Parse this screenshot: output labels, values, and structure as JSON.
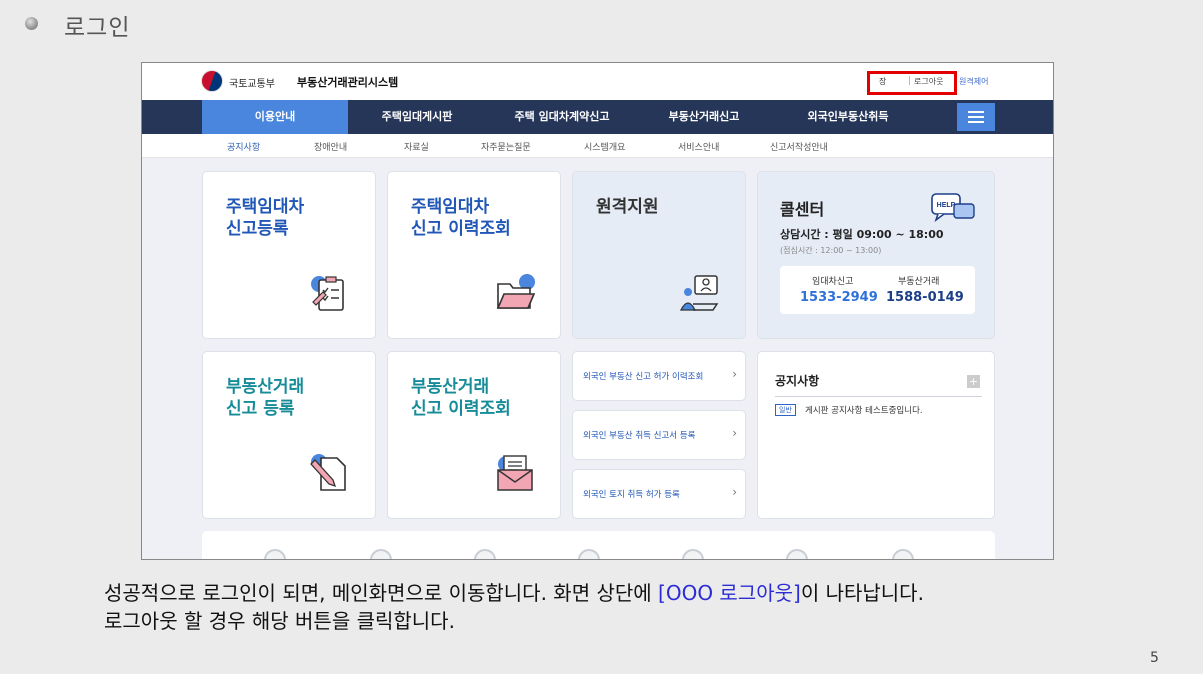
{
  "slide": {
    "title": "로그인",
    "page_number": "5",
    "caption_part1": "성공적으로 로그인이 되면, 메인화면으로 이동합니다. 화면 상단에 ",
    "caption_highlight": "[OOO 로그아웃]",
    "caption_part2": "이 나타납니다.",
    "caption_line2": "로그아웃 할 경우 해당 버튼을 클릭합니다."
  },
  "header": {
    "ministry": "국토교통부",
    "system_name": "부동산거래관리시스템",
    "user_name": "장",
    "logout_label": "로그아웃",
    "remote_label": "원격제어"
  },
  "gnb": {
    "items": [
      "이용안내",
      "주택임대게시판",
      "주택 임대차계약신고",
      "부동산거래신고",
      "외국인부동산취득"
    ]
  },
  "subnav": {
    "items": [
      "공지사항",
      "장애안내",
      "자료실",
      "자주묻는질문",
      "시스템개요",
      "서비스안내",
      "신고서작성안내"
    ]
  },
  "cards": {
    "rent_register": [
      "주택임대차",
      "신고등록"
    ],
    "rent_history": [
      "주택임대차",
      "신고 이력조회"
    ],
    "remote_support": "원격지원",
    "trade_register": [
      "부동산거래",
      "신고 등록"
    ],
    "trade_history": [
      "부동산거래",
      "신고 이력조회"
    ]
  },
  "call_center": {
    "title": "콜센터",
    "hours": "상담시간 : 평일 09:00 ~ 18:00",
    "break": "(점심시간 : 12:00 ~ 13:00)",
    "help_badge": "HELP",
    "rent_label": "임대차신고",
    "rent_number": "1533-2949",
    "trade_label": "부동산거래",
    "trade_number": "1588-0149"
  },
  "foreign_links": [
    "외국인 부동산 신고 허가 이력조회",
    "외국인 부동산 취득 신고서 등록",
    "외국인 토지 취득 허가 등록"
  ],
  "notice": {
    "title": "공지사항",
    "plus": "+",
    "badge": "일반",
    "item": "게시판 공지사항 테스트중입니다."
  },
  "colors": {
    "gnb_bg": "#263659",
    "accent": "#4a86de",
    "highlight_box": "#e30000",
    "title_blue": "#2157b6",
    "title_teal": "#178c99"
  }
}
